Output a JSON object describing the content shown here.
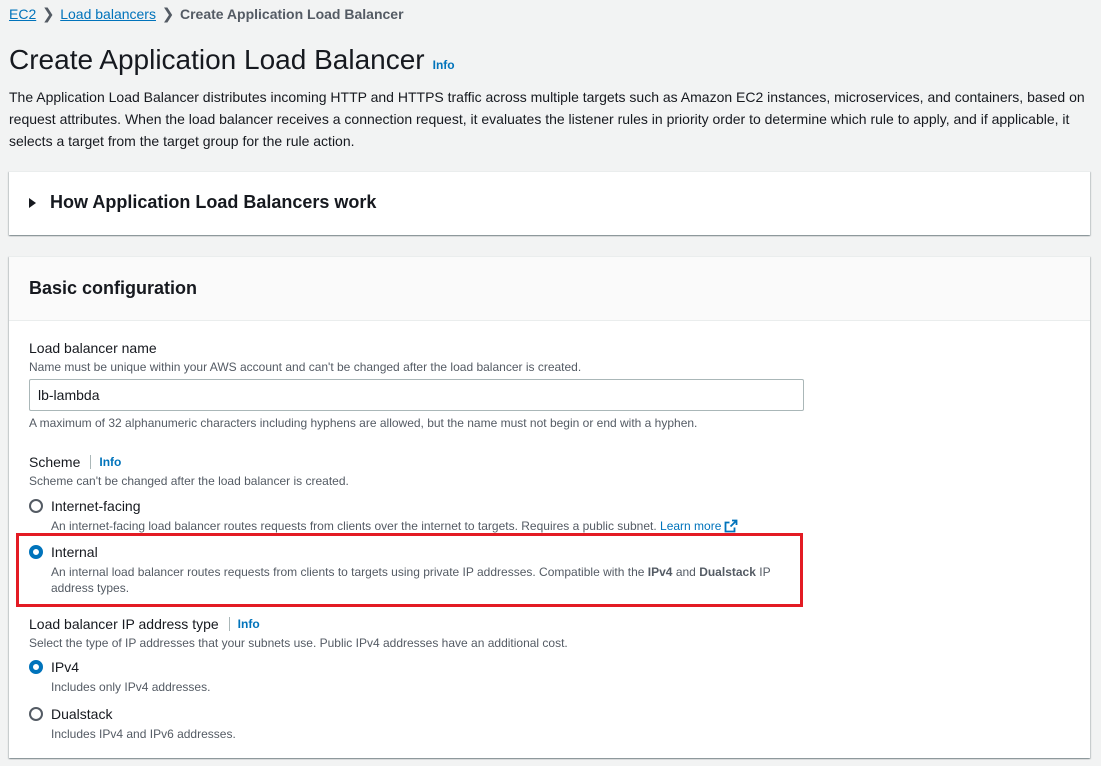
{
  "breadcrumb": {
    "items": [
      "EC2",
      "Load balancers"
    ],
    "current": "Create Application Load Balancer"
  },
  "page": {
    "title": "Create Application Load Balancer",
    "info_label": "Info",
    "description": "The Application Load Balancer distributes incoming HTTP and HTTPS traffic across multiple targets such as Amazon EC2 instances, microservices, and containers, based on request attributes. When the load balancer receives a connection request, it evaluates the listener rules in priority order to determine which rule to apply, and if applicable, it selects a target from the target group for the rule action."
  },
  "how_section": {
    "title": "How Application Load Balancers work"
  },
  "basic_config": {
    "title": "Basic configuration",
    "name_field": {
      "label": "Load balancer name",
      "description": "Name must be unique within your AWS account and can't be changed after the load balancer is created.",
      "value": "lb-lambda",
      "constraint": "A maximum of 32 alphanumeric characters including hyphens are allowed, but the name must not begin or end with a hyphen."
    },
    "scheme": {
      "label": "Scheme",
      "info_label": "Info",
      "description": "Scheme can't be changed after the load balancer is created.",
      "options": [
        {
          "label": "Internet-facing",
          "description": "An internet-facing load balancer routes requests from clients over the internet to targets. Requires a public subnet.",
          "link": "Learn more",
          "selected": false
        },
        {
          "label": "Internal",
          "description_pre": "An internal load balancer routes requests from clients to targets using private IP addresses. Compatible with the",
          "bold1": "IPv4",
          "mid": "and",
          "bold2": "Dualstack",
          "description_post": "IP",
          "description_line2": "address types.",
          "selected": true
        }
      ]
    },
    "ip_type": {
      "label": "Load balancer IP address type",
      "info_label": "Info",
      "description": "Select the type of IP addresses that your subnets use. Public IPv4 addresses have an additional cost.",
      "options": [
        {
          "label": "IPv4",
          "description": "Includes only IPv4 addresses.",
          "selected": true
        },
        {
          "label": "Dualstack",
          "description": "Includes IPv4 and IPv6 addresses.",
          "selected": false
        }
      ]
    }
  },
  "colors": {
    "link": "#0073bb",
    "highlight": "#e31b23",
    "background": "#f2f3f3"
  }
}
